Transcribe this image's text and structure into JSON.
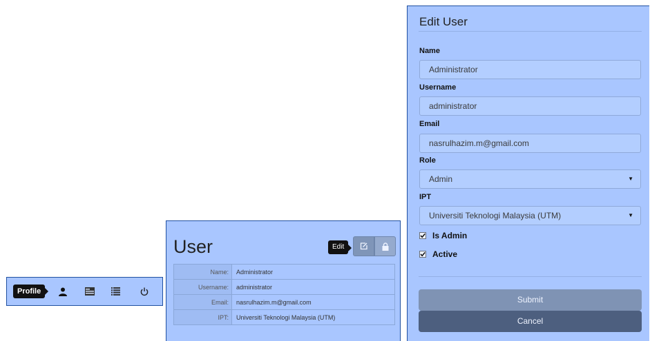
{
  "toolbar": {
    "tooltip": "Profile",
    "icons": [
      "user-icon",
      "id-card-icon",
      "list-icon",
      "power-icon"
    ]
  },
  "user_card": {
    "title": "User",
    "edit_tooltip": "Edit",
    "rows": [
      {
        "key": "Name:",
        "value": "Administrator"
      },
      {
        "key": "Username:",
        "value": "administrator"
      },
      {
        "key": "Email:",
        "value": "nasrulhazim.m@gmail.com"
      },
      {
        "key": "IPT:",
        "value": "Universiti Teknologi Malaysia (UTM)"
      }
    ]
  },
  "edit_modal": {
    "title": "Edit User",
    "name_label": "Name",
    "name_value": "Administrator",
    "username_label": "Username",
    "username_value": "administrator",
    "email_label": "Email",
    "email_value": "nasrulhazim.m@gmail.com",
    "role_label": "Role",
    "role_value": "Admin",
    "ipt_label": "IPT",
    "ipt_value": "Universiti Teknologi Malaysia (UTM)",
    "is_admin_label": "Is Admin",
    "is_admin_checked": true,
    "active_label": "Active",
    "active_checked": true,
    "submit_label": "Submit",
    "cancel_label": "Cancel"
  },
  "colors": {
    "panel_bg": "#a9c6ff",
    "border": "#1f4fa0",
    "submit_bg": "#7f93b4",
    "cancel_bg": "#4d5f7f"
  }
}
